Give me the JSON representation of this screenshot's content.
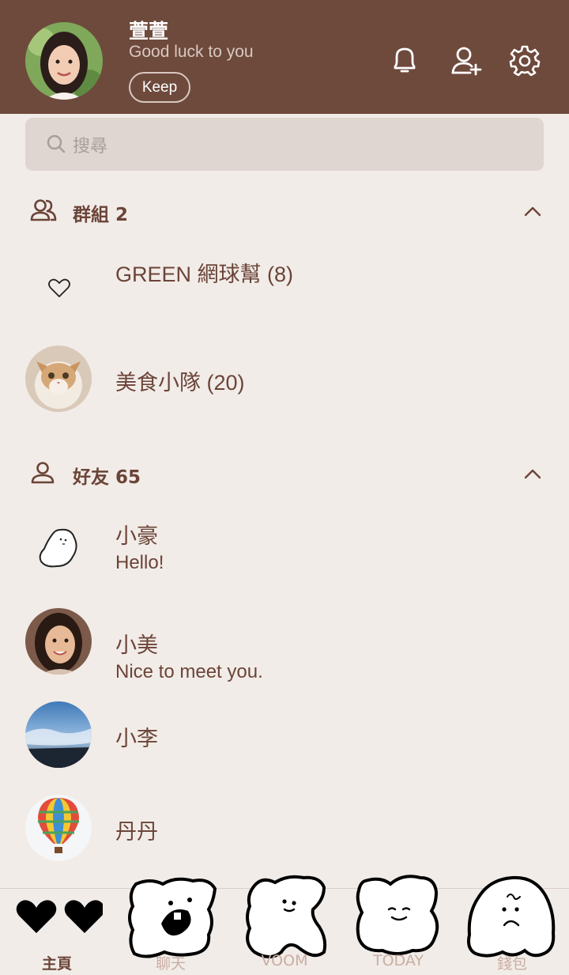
{
  "profile": {
    "name": "萱萱",
    "status": "Good luck to you",
    "keep_label": "Keep"
  },
  "header_icons": [
    "bell-icon",
    "add-friend-icon",
    "gear-icon"
  ],
  "search": {
    "placeholder": "搜尋"
  },
  "groups": {
    "title": "群組 2",
    "items": [
      {
        "name": "GREEN 網球幫 (8)",
        "avatar": "heart-outline-icon"
      },
      {
        "name": "美食小隊 (20)",
        "avatar": "cat-photo"
      }
    ]
  },
  "friends": {
    "title": "好友 65",
    "items": [
      {
        "name": "小豪",
        "message": "Hello!",
        "avatar": "ghost-doodle"
      },
      {
        "name": "小美",
        "message": "Nice to meet you.",
        "avatar": "woman-photo"
      },
      {
        "name": "小李",
        "message": "",
        "avatar": "sky-photo"
      },
      {
        "name": "丹丹",
        "message": "",
        "avatar": "balloon-photo"
      }
    ]
  },
  "tabs": [
    {
      "label": "主頁",
      "active": true
    },
    {
      "label": "聊天",
      "active": false
    },
    {
      "label": "VOOM",
      "active": false
    },
    {
      "label": "TODAY",
      "active": false
    },
    {
      "label": "錢包",
      "active": false
    }
  ],
  "colors": {
    "header_bg": "#6e4a3c",
    "page_bg": "#f2ece8",
    "text": "#6b4438",
    "search_bg": "#dfd6d1"
  }
}
